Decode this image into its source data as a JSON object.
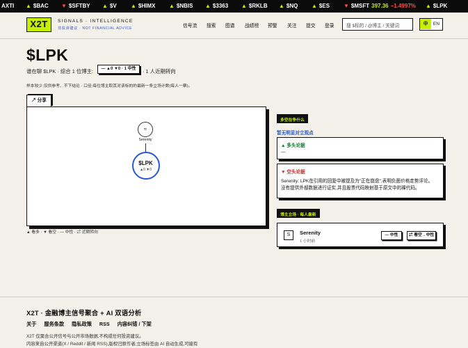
{
  "ticker": [
    {
      "dir": "",
      "symbol": "AXTI"
    },
    {
      "dir": "▲",
      "symbol": "$BAC"
    },
    {
      "dir": "▼",
      "symbol": "$SFTBY"
    },
    {
      "dir": "▲",
      "symbol": "$V"
    },
    {
      "dir": "▲",
      "symbol": "$HIMX"
    },
    {
      "dir": "▲",
      "symbol": "$NBIS"
    },
    {
      "dir": "▲",
      "symbol": "$3363"
    },
    {
      "dir": "▲",
      "symbol": "$RKLB"
    },
    {
      "dir": "▲",
      "symbol": "$NQ"
    },
    {
      "dir": "▲",
      "symbol": "$ES"
    },
    {
      "dir": "▼",
      "symbol": "$MSFT",
      "price": "397.36",
      "change": "−1.4997%"
    },
    {
      "dir": "▲",
      "symbol": "$LPK"
    }
  ],
  "header": {
    "logo": "X2T",
    "tagline": "SIGNALS · INTELLIGENCE",
    "disclaimer": "非投资建议 · NOT FINANCIAL ADVICE",
    "nav": [
      "信号流",
      "搜索",
      "图谱",
      "战绩榜",
      "预警",
      "关注",
      "提交",
      "登录"
    ],
    "search_placeholder": "搜 $标的 / @博主 / 关键词",
    "lang": {
      "zh": "中",
      "en": "EN"
    }
  },
  "page": {
    "title": "$LPK",
    "subline_prefix": "谁在聊 $LPK · 综合 1 位博主:",
    "chip": "— ▲0 ▼0 · 1 中性",
    "subline_suffix": "· 1 人近期转向",
    "note": "样本较少,仅供参考、不下结论 · 口径:每位博主取其对该标的的最新一条立场计数(每人一票)。",
    "share": "↗ 分享"
  },
  "graph": {
    "source_icon": "≈",
    "source_name": "Serenity",
    "target_ticker": "$LPK",
    "target_counts": "▲0 ▼0",
    "legend": "▲ 看多 · ▼ 看空 · — 中性 · ⇄ 近期转向"
  },
  "sidebar": {
    "debate_label": "多空在争什么",
    "no_opposition": "暂无明显对立观点",
    "bull": {
      "title": "▲ 多头论据",
      "text": "—"
    },
    "bear": {
      "title": "▼ 空头论据",
      "line1": "Serenity: LPK在引用的回复中被提及为\"正在崩盘\",表明负面价格走势评论。",
      "line2": "没有提供外部数据进行证实,并且股票代码映射基于原文中的裸代码。"
    },
    "stance_label": "博主立场 · 每人最新",
    "feed": [
      {
        "avatar": "S",
        "name": "Serenity",
        "time": "1 小时前",
        "stance": "— 中性",
        "shift": "⇄ 看空→中性"
      }
    ]
  },
  "footer": {
    "title": "X2T · 金融博主信号聚合 + AI 双语分析",
    "links": [
      "关于",
      "服务条款",
      "隐私政策",
      "RSS",
      "内容纠错 / 下架"
    ],
    "disclaimer1": "X2T 仅聚合公开信号与公开市场数据,不构成任何投资建议。",
    "disclaimer2": "内容来自公开渠道(X / Reddit / 新闻 RSS),版权归原作者;立场标签由 AI 自动生成,可能有"
  }
}
